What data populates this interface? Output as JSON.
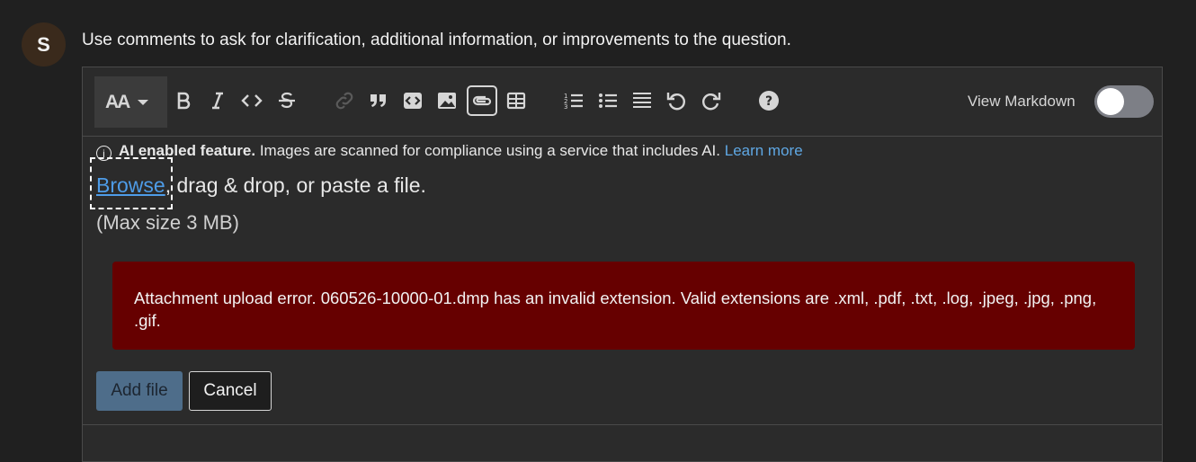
{
  "avatar": {
    "initial": "S"
  },
  "prompt": "Use comments to ask for clarification, additional information, or improvements to the question.",
  "toolbar": {
    "heading_label": "AA",
    "view_markdown_label": "View Markdown",
    "view_markdown_on": false
  },
  "upload": {
    "ai_bold": "AI enabled feature.",
    "ai_text": " Images are scanned for compliance using a service that includes AI.",
    "learn_more": "Learn more",
    "browse_label": "Browse",
    "browse_rest": ", drag & drop, or paste a file.",
    "max_size": "(Max size 3 MB)",
    "error": "Attachment upload error. 060526-10000-01.dmp has an invalid extension. Valid extensions are .xml, .pdf, .txt, .log, .jpeg, .jpg, .png, .gif.",
    "add_file": "Add file",
    "cancel": "Cancel"
  },
  "colors": {
    "background": "#202020",
    "error_bg": "#660000",
    "link": "#4e9ce8",
    "primary_button": "#4e6d8a"
  }
}
